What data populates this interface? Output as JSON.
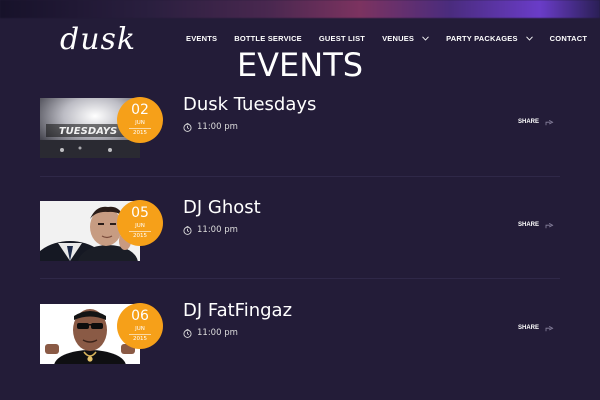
{
  "brand": {
    "logo_text": "dusk"
  },
  "nav": {
    "items": [
      {
        "label": "EVENTS",
        "has_dropdown": false
      },
      {
        "label": "BOTTLE SERVICE",
        "has_dropdown": false
      },
      {
        "label": "GUEST LIST",
        "has_dropdown": false
      },
      {
        "label": "VENUES",
        "has_dropdown": true
      },
      {
        "label": "PARTY PACKAGES",
        "has_dropdown": true
      },
      {
        "label": "CONTACT",
        "has_dropdown": false
      }
    ]
  },
  "page": {
    "title": "EVENTS"
  },
  "events": [
    {
      "title": "Dusk Tuesdays",
      "day": "02",
      "month": "JUN",
      "year": "2015",
      "time": "11:00 pm",
      "share_label": "SHARE",
      "thumb_text": "TUESDAYS"
    },
    {
      "title": "DJ Ghost",
      "day": "05",
      "month": "JUN",
      "year": "2015",
      "time": "11:00 pm",
      "share_label": "SHARE"
    },
    {
      "title": "DJ FatFingaz",
      "day": "06",
      "month": "JUN",
      "year": "2015",
      "time": "11:00 pm",
      "share_label": "SHARE"
    }
  ],
  "colors": {
    "background": "#231c38",
    "accent": "#f6a019",
    "text": "#ffffff",
    "divider": "#2f2848"
  },
  "icons": [
    "clock-icon",
    "share-icon",
    "chevron-down-icon"
  ]
}
